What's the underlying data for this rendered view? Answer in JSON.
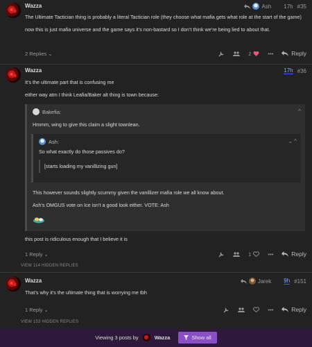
{
  "posts": [
    {
      "username": "Wazza",
      "reply_to": "Ash",
      "time": "17h",
      "number": "#35",
      "paragraphs": [
        "The Ultimate Tactician thing is probably a literal Tactician role (they choose what mafia gets what role at the start of the game)",
        "now this is just mafia universe and the game says it’s non-bastard so I don’t think we’re being lied to about that."
      ],
      "replies_label": "2 Replies",
      "likes": "2",
      "reply_label": "Reply"
    },
    {
      "username": "Wazza",
      "time": "17h",
      "number": "#36",
      "intro": [
        "It’s the ultimate part that is confusing me",
        "either way atm I think Leafia/Baker alt thing is town because:"
      ],
      "quote": {
        "author": "Bakefia:",
        "text": "Hmmm, wing to give this claim a slight townlean.",
        "nested": {
          "author": "Ash:",
          "question": "So what exactly do those passives do?",
          "blockquote": "[starts loading my vanillizing gun]"
        },
        "after": [
          "This however sounds slightly scummy given the vanillizer mafia role we all know about.",
          "Ash’s OMGUS vote on Ice isn’t a good look either. VOTE: Ash"
        ]
      },
      "outro": "this post is ridiculous enough that I believe it is",
      "replies_label": "1 Reply",
      "likes": "1",
      "reply_label": "Reply"
    },
    {
      "username": "Wazza",
      "reply_to": "Jarek",
      "time": "9h",
      "number": "#151",
      "paragraphs": [
        "That’s why it’s the ultimate thing that is worrying me tbh"
      ],
      "replies_label": "1 Reply",
      "reply_label": "Reply"
    }
  ],
  "hidden": [
    "VIEW 114 HIDDEN REPLIES",
    "VIEW 153 HIDDEN REPLIES"
  ],
  "footer": {
    "viewing": "Viewing 3 posts by",
    "user": "Wazza",
    "show_all": "Show all"
  },
  "colors": {
    "background": "#222222",
    "accent": "#8a4fc7",
    "like_active": "#e45777",
    "unread_link": "#3a5ff0"
  }
}
